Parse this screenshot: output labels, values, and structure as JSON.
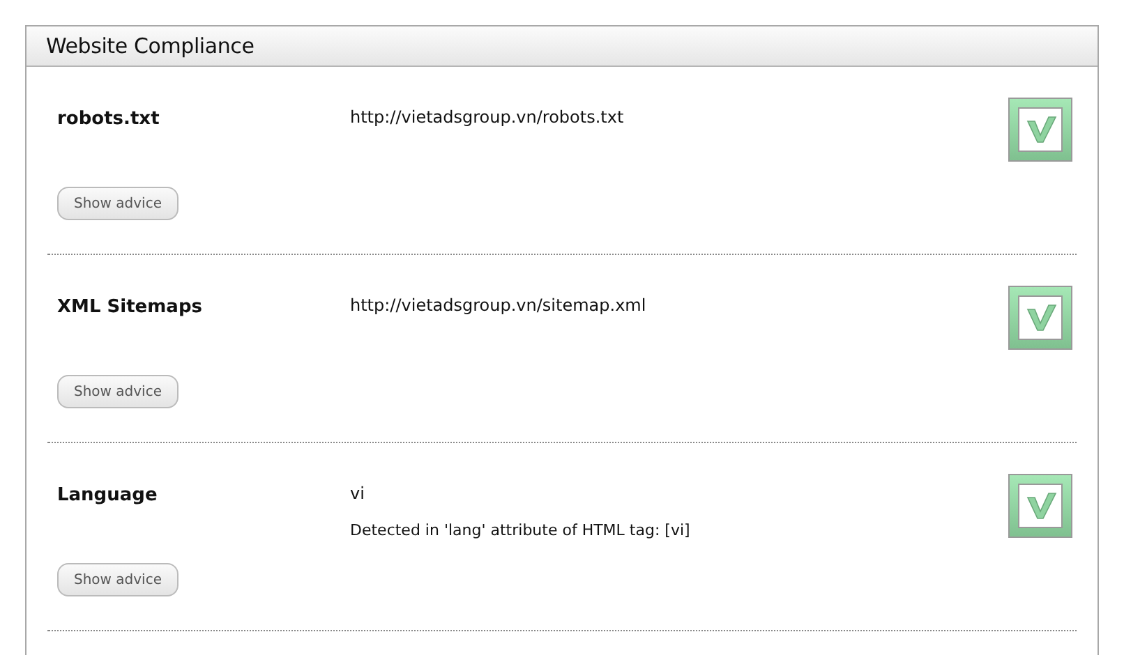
{
  "panel": {
    "title": "Website Compliance"
  },
  "checks": [
    {
      "name": "robots.txt",
      "lines": [
        "http://vietadsgroup.vn/robots.txt"
      ],
      "passed": true,
      "button": "Show advice"
    },
    {
      "name": "XML Sitemaps",
      "lines": [
        "http://vietadsgroup.vn/sitemap.xml"
      ],
      "passed": true,
      "button": "Show advice"
    },
    {
      "name": "Language",
      "lines": [
        "vi",
        "Detected in 'lang' attribute of HTML tag: [vi]"
      ],
      "passed": true,
      "button": "Show advice"
    }
  ]
}
